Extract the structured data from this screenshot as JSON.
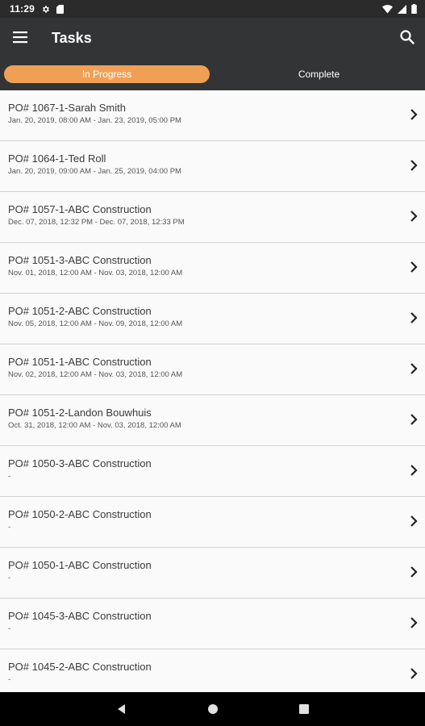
{
  "status_bar": {
    "time": "11:29"
  },
  "app_bar": {
    "title": "Tasks"
  },
  "tabs": [
    {
      "label": "In Progress",
      "active": true
    },
    {
      "label": "Complete",
      "active": false
    }
  ],
  "colors": {
    "accent": "#f0a055",
    "app_bar": "#323436",
    "status_bar": "#2b2b2b"
  },
  "tasks": [
    {
      "title": "PO# 1067-1-Sarah Smith",
      "dates": "Jan. 20, 2019, 08:00 AM - Jan. 23, 2019, 05:00 PM"
    },
    {
      "title": "PO# 1064-1-Ted Roll",
      "dates": "Jan. 20, 2019, 09:00 AM - Jan. 25, 2019, 04:00 PM"
    },
    {
      "title": "PO# 1057-1-ABC Construction",
      "dates": "Dec. 07, 2018, 12:32 PM - Dec. 07, 2018, 12:33 PM"
    },
    {
      "title": "PO# 1051-3-ABC Construction",
      "dates": "Nov. 01, 2018, 12:00 AM - Nov. 03, 2018, 12:00 AM"
    },
    {
      "title": "PO# 1051-2-ABC Construction",
      "dates": "Nov. 05, 2018, 12:00 AM - Nov. 09, 2018, 12:00 AM"
    },
    {
      "title": "PO# 1051-1-ABC Construction",
      "dates": "Nov. 02, 2018, 12:00 AM - Nov. 03, 2018, 12:00 AM"
    },
    {
      "title": "PO# 1051-2-Landon Bouwhuis",
      "dates": "Oct. 31, 2018, 12:00 AM - Nov. 03, 2018, 12:00 AM"
    },
    {
      "title": "PO# 1050-3-ABC Construction",
      "dates": "-"
    },
    {
      "title": "PO# 1050-2-ABC Construction",
      "dates": "-"
    },
    {
      "title": "PO# 1050-1-ABC Construction",
      "dates": "-"
    },
    {
      "title": "PO# 1045-3-ABC Construction",
      "dates": "-"
    },
    {
      "title": "PO# 1045-2-ABC Construction",
      "dates": "-"
    }
  ]
}
